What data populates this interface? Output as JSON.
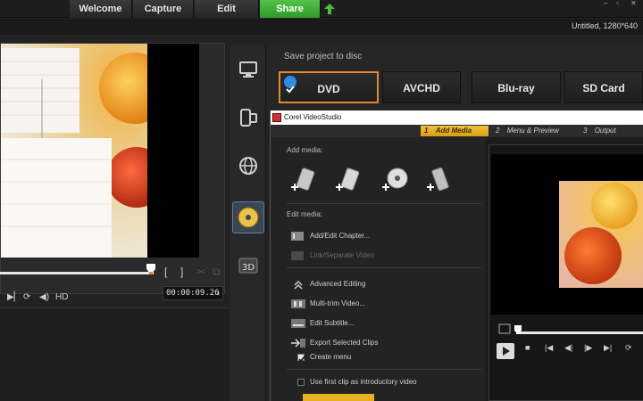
{
  "nav": {
    "tabs": [
      {
        "label": "Welcome"
      },
      {
        "label": "Capture"
      },
      {
        "label": "Edit"
      },
      {
        "label": "Share",
        "active": true
      }
    ]
  },
  "window": {
    "controls": [
      "–",
      "▫",
      "✕"
    ]
  },
  "project": {
    "title": "Untitled, 1280*640"
  },
  "preview": {
    "timecode": "00:00:09.26",
    "hd_label": "HD",
    "playhead_position": 0.97
  },
  "share": {
    "save_label": "Save project to disc",
    "options": [
      {
        "label": "DVD",
        "selected": true
      },
      {
        "label": "AVCHD"
      },
      {
        "label": "Blu-ray"
      },
      {
        "label": "SD Card"
      }
    ]
  },
  "dialog": {
    "title": "Corel VideoStudio",
    "steps": [
      {
        "num": "1",
        "label": "Add Media",
        "active": true
      },
      {
        "num": "2",
        "label": "Menu & Preview"
      },
      {
        "num": "3",
        "label": "Output"
      }
    ],
    "add_media_label": "Add media:",
    "edit_media_label": "Edit media:",
    "edit_items": [
      {
        "label": "Add/Edit Chapter...",
        "enabled": true
      },
      {
        "label": "Link/Separate Video",
        "enabled": false
      }
    ],
    "advanced_label": "Advanced Editing",
    "advanced_items": [
      {
        "label": "Multi-trim Video..."
      },
      {
        "label": "Edit Subtitle..."
      },
      {
        "label": "Export Selected Clips"
      }
    ],
    "create_menu": {
      "label": "Create menu",
      "checked": true
    },
    "intro_video": {
      "label": "Use first clip as introductory video",
      "checked": false
    }
  },
  "colors": {
    "share_tab": "#3fae35",
    "selected_outline": "#e08a2c",
    "step_active": "#e5ad2a"
  }
}
